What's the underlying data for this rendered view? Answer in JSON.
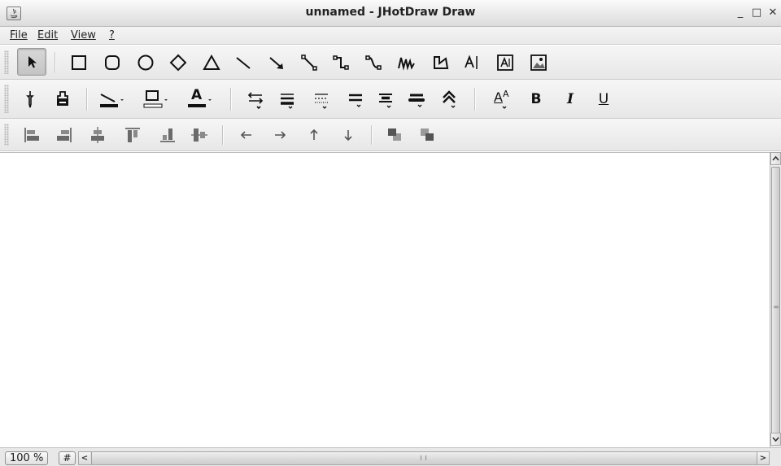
{
  "window": {
    "title": "unnamed - JHotDraw Draw",
    "minimize_glyph": "_",
    "maximize_glyph": "□",
    "close_glyph": "✕"
  },
  "menubar": {
    "items": [
      {
        "label": "File"
      },
      {
        "label": "Edit"
      },
      {
        "label": "View"
      },
      {
        "label": "?"
      }
    ]
  },
  "toolbar_creation": {
    "selected_tool": "selection-tool",
    "tools": [
      "selection-tool",
      "rectangle-tool",
      "round-rectangle-tool",
      "ellipse-tool",
      "diamond-tool",
      "triangle-tool",
      "line-tool",
      "arrow-tool",
      "connector-tool",
      "elbow-connector-tool",
      "curved-connector-tool",
      "scribble-tool",
      "polygon-tool",
      "text-tool",
      "text-area-tool",
      "image-tool"
    ]
  },
  "toolbar_attributes": {
    "tools": [
      "pick-attributes-tool",
      "apply-attributes-tool",
      "stroke-color-dropdown",
      "fill-color-dropdown",
      "text-color-dropdown",
      "stroke-decoration-dropdown",
      "stroke-width-dropdown",
      "stroke-dash-dropdown",
      "stroke-type-dropdown",
      "stroke-placement-dropdown",
      "stroke-cap-dropdown",
      "stroke-join-dropdown",
      "font-dropdown",
      "bold-button",
      "italic-button",
      "underline-button"
    ],
    "font_glyph": "A",
    "bold_glyph": "B",
    "italic_glyph": "I",
    "underline_glyph": "U",
    "text_color_glyph": "A"
  },
  "toolbar_alignment": {
    "tools": [
      "align-west",
      "align-east",
      "align-horizontal-center",
      "align-north",
      "align-south",
      "align-vertical-center",
      "move-left",
      "move-right",
      "move-up",
      "move-down",
      "bring-to-front",
      "send-to-back"
    ]
  },
  "statusbar": {
    "zoom": "100 %",
    "grid_toggle": "#",
    "scroll_left": "<",
    "scroll_right": ">",
    "scroll_grip": "III"
  },
  "colors": {
    "titlebar": "#e4e4e4",
    "toolbar": "#eeeeee",
    "canvas": "#ffffff",
    "icon": "#1a1a1a"
  }
}
